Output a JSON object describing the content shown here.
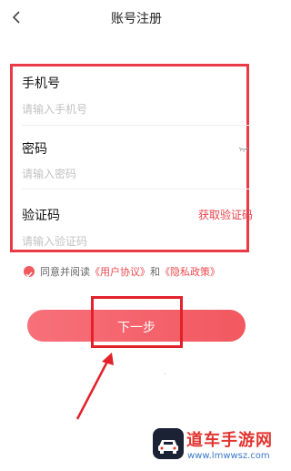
{
  "header": {
    "title": "账号注册",
    "back_icon": "chevron-left-icon"
  },
  "form": {
    "phone_label": "手机号",
    "phone_placeholder": "请输入手机号",
    "password_label": "密码",
    "password_placeholder": "请输入密码",
    "password_toggle_icon": "eye-closed-icon",
    "code_label": "验证码",
    "code_placeholder": "请输入验证码",
    "get_code_label": "获取验证码"
  },
  "agreement": {
    "prefix": "同意并阅读",
    "user_agreement": "《用户协议》",
    "conjunction": "和",
    "privacy_policy": "《隐私政策》"
  },
  "next_button": {
    "label": "下一步"
  },
  "watermark": {
    "title": "道车手游网",
    "url": "www.lmwwsz.com"
  },
  "colors": {
    "accent": "#f25860",
    "highlight_frame": "#ea3a47",
    "link": "#ea4a4f"
  }
}
